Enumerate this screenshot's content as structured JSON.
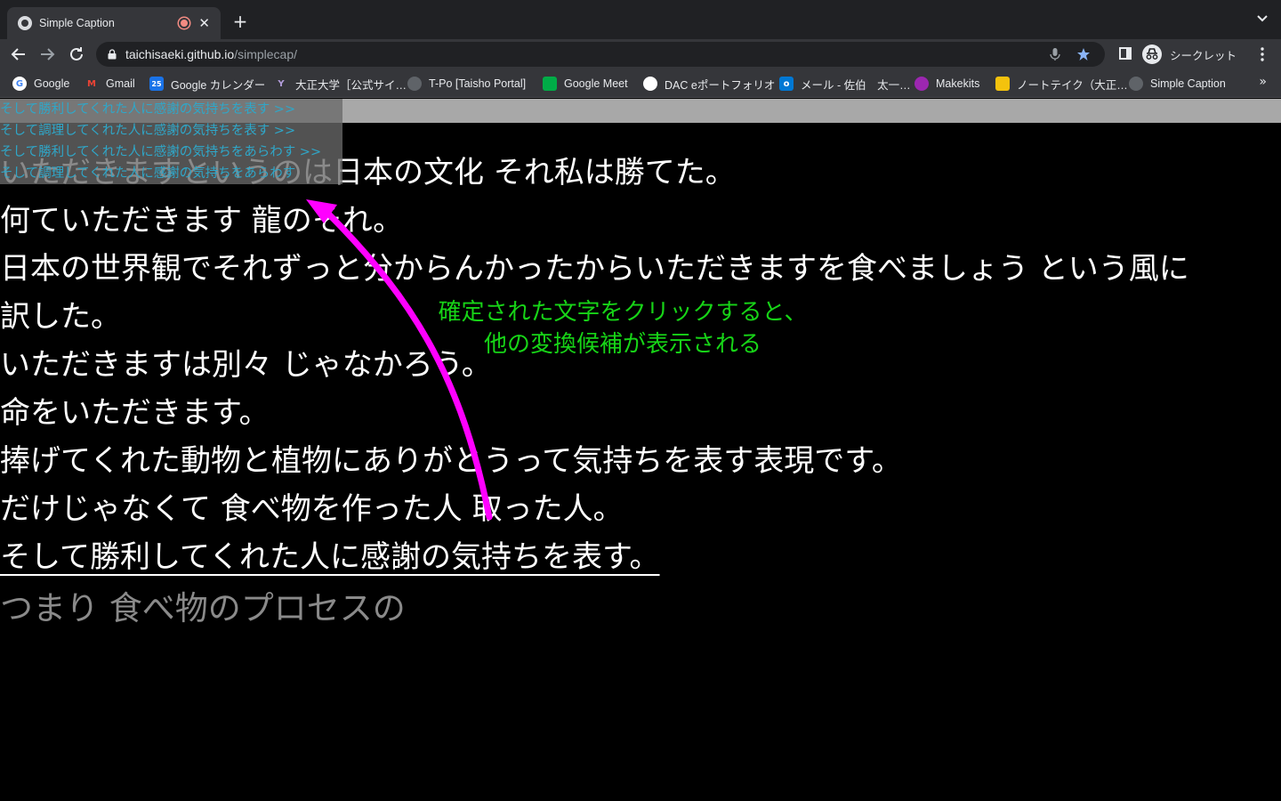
{
  "browser": {
    "tab": {
      "title": "Simple Caption"
    },
    "omnibox": {
      "domain": "taichisaeki.github.io",
      "path": "/simplecap/"
    },
    "profile_label": "シークレット",
    "bookmarks": [
      {
        "label": "Google",
        "icon": "google-icon",
        "color": "#4285f4"
      },
      {
        "label": "Gmail",
        "icon": "gmail-icon",
        "color": "#ea4335"
      },
      {
        "label": "Google カレンダー",
        "icon": "calendar-icon",
        "color": "#1a73e8"
      },
      {
        "label": "大正大学［公式サイ…",
        "icon": "university-icon",
        "color": "#6a3d9a"
      },
      {
        "label": "T-Po [Taisho Portal]",
        "icon": "globe-icon",
        "color": "#5f6368"
      },
      {
        "label": "Google Meet",
        "icon": "meet-icon",
        "color": "#00ac47"
      },
      {
        "label": "DAC eポートフォリオ",
        "icon": "dac-icon",
        "color": "#ffffff"
      },
      {
        "label": "メール - 佐伯　太一…",
        "icon": "outlook-icon",
        "color": "#0078d4"
      },
      {
        "label": "Makekits",
        "icon": "makekits-icon",
        "color": "#9c27b0"
      },
      {
        "label": "ノートテイク（大正…",
        "icon": "notetake-icon",
        "color": "#f4c20d"
      },
      {
        "label": "Simple Caption",
        "icon": "globe-icon",
        "color": "#5f6368"
      }
    ]
  },
  "candidates": [
    "そして勝利してくれた人に感謝の気持ちを表す >>",
    "そして調理してくれた人に感謝の気持ちを表す >>",
    "そして勝利してくれた人に感謝の気持ちをあらわす >>",
    "そして調理してくれた人に感謝の気持ちをあらわす"
  ],
  "caption_lines": [
    "いただきますというのは日本の文化 それ私は勝てた。",
    "何ていただきます 龍のそれ。",
    "日本の世界観でそれずっと分からんかったからいただきますを食べましょう という風に",
    "訳した。",
    "いただきますは別々 じゃなかろう。",
    "命をいただきます。",
    "捧げてくれた動物と植物にありがとうって気持ちを表す表現です。",
    "だけじゃなくて 食べ物を作った人 取った人。"
  ],
  "selected_line": "そして勝利してくれた人に感謝の気持ちを表す。",
  "interim_line": "つまり 食べ物のプロセスの",
  "annotation": {
    "line1": "確定された文字をクリックすると、",
    "line2": "他の変換候補が表示される",
    "text_color": "#17d417",
    "arrow_color": "#ff00ff"
  }
}
